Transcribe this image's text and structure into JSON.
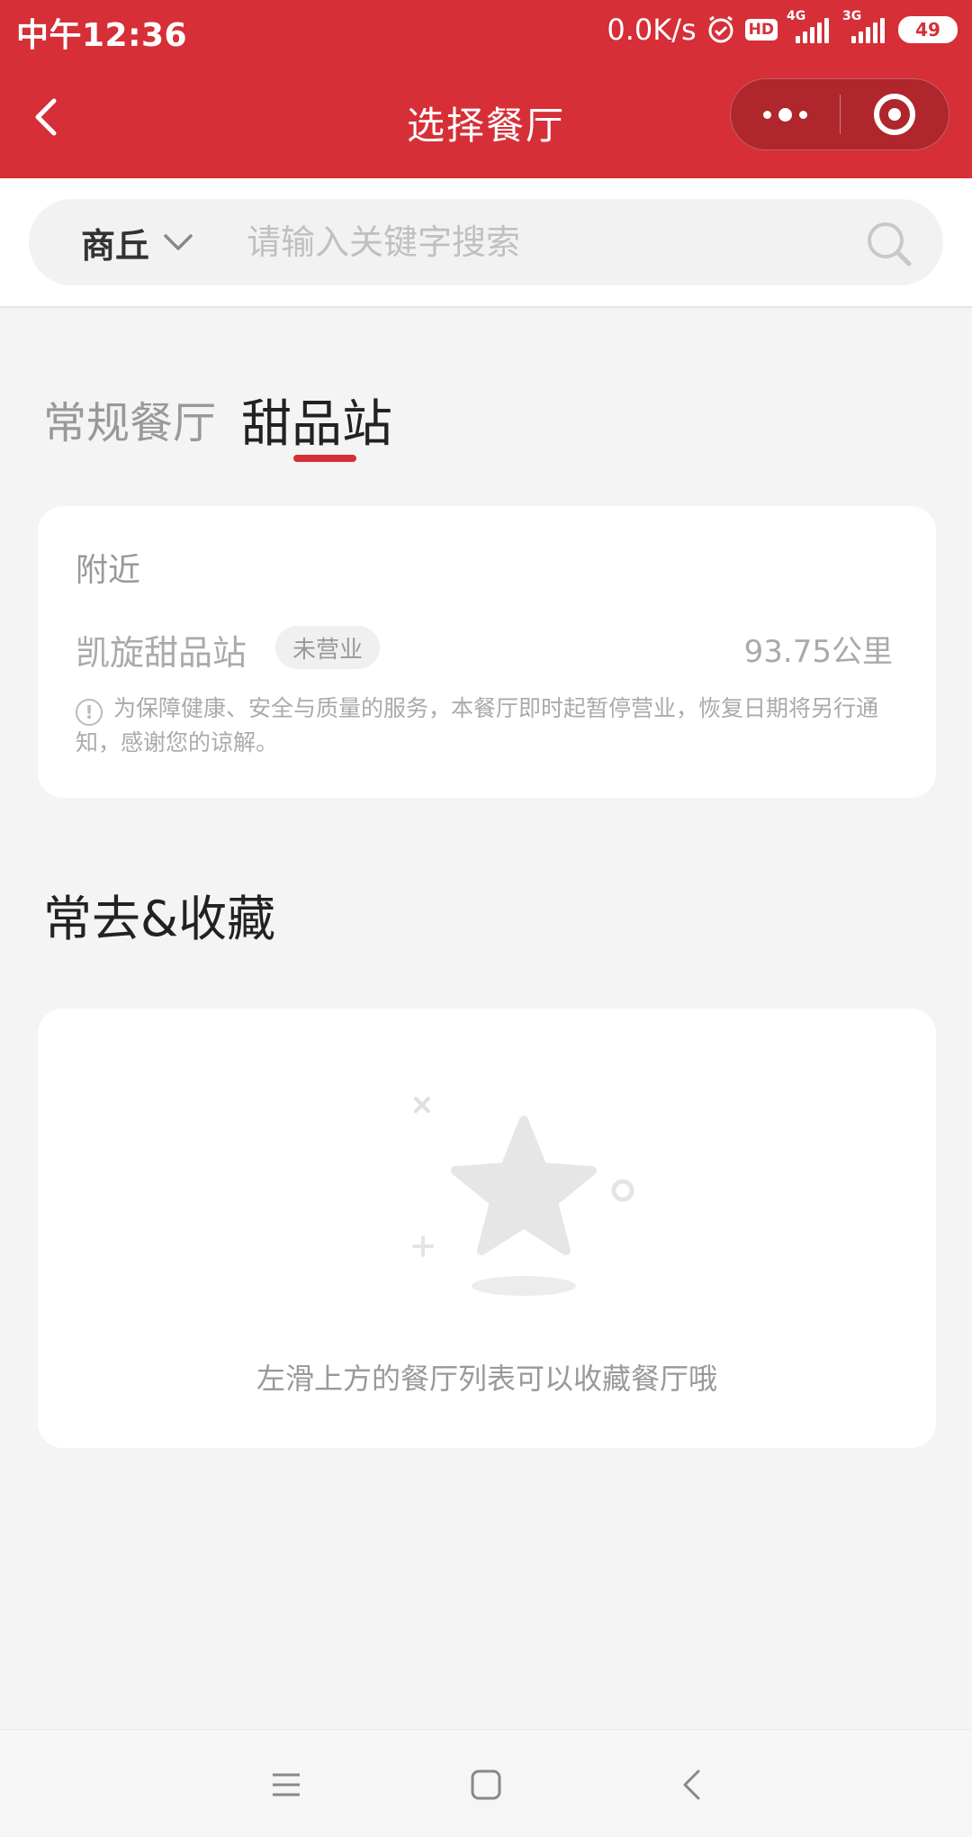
{
  "status_bar": {
    "time": "中午12:36",
    "net_speed": "0.0K/s",
    "hd": "HD",
    "sig1_label": "4G",
    "sig2_label": "3G",
    "battery": "49"
  },
  "nav": {
    "title": "选择餐厅"
  },
  "search": {
    "city": "商丘",
    "placeholder": "请输入关键字搜索"
  },
  "tabs": [
    {
      "label": "常规餐厅",
      "active": false
    },
    {
      "label": "甜品站",
      "active": true
    }
  ],
  "nearby": {
    "title": "附近",
    "restaurant": {
      "name": "凯旋甜品站",
      "status": "未营业",
      "distance": "93.75公里",
      "notice": "为保障健康、安全与质量的服务，本餐厅即时起暂停营业，恢复日期将另行通知，感谢您的谅解。"
    }
  },
  "favorites": {
    "title": "常去&收藏",
    "empty_text": "左滑上方的餐厅列表可以收藏餐厅哦"
  },
  "colors": {
    "brand_red": "#d62f38",
    "background": "#f4f4f4"
  },
  "icons": {
    "back": "back-arrow-icon",
    "more": "more-dots-icon",
    "close": "target-close-icon",
    "search": "search-icon",
    "dropdown": "chevron-down-icon",
    "notice": "info-circle-icon",
    "empty": "star-icon"
  }
}
